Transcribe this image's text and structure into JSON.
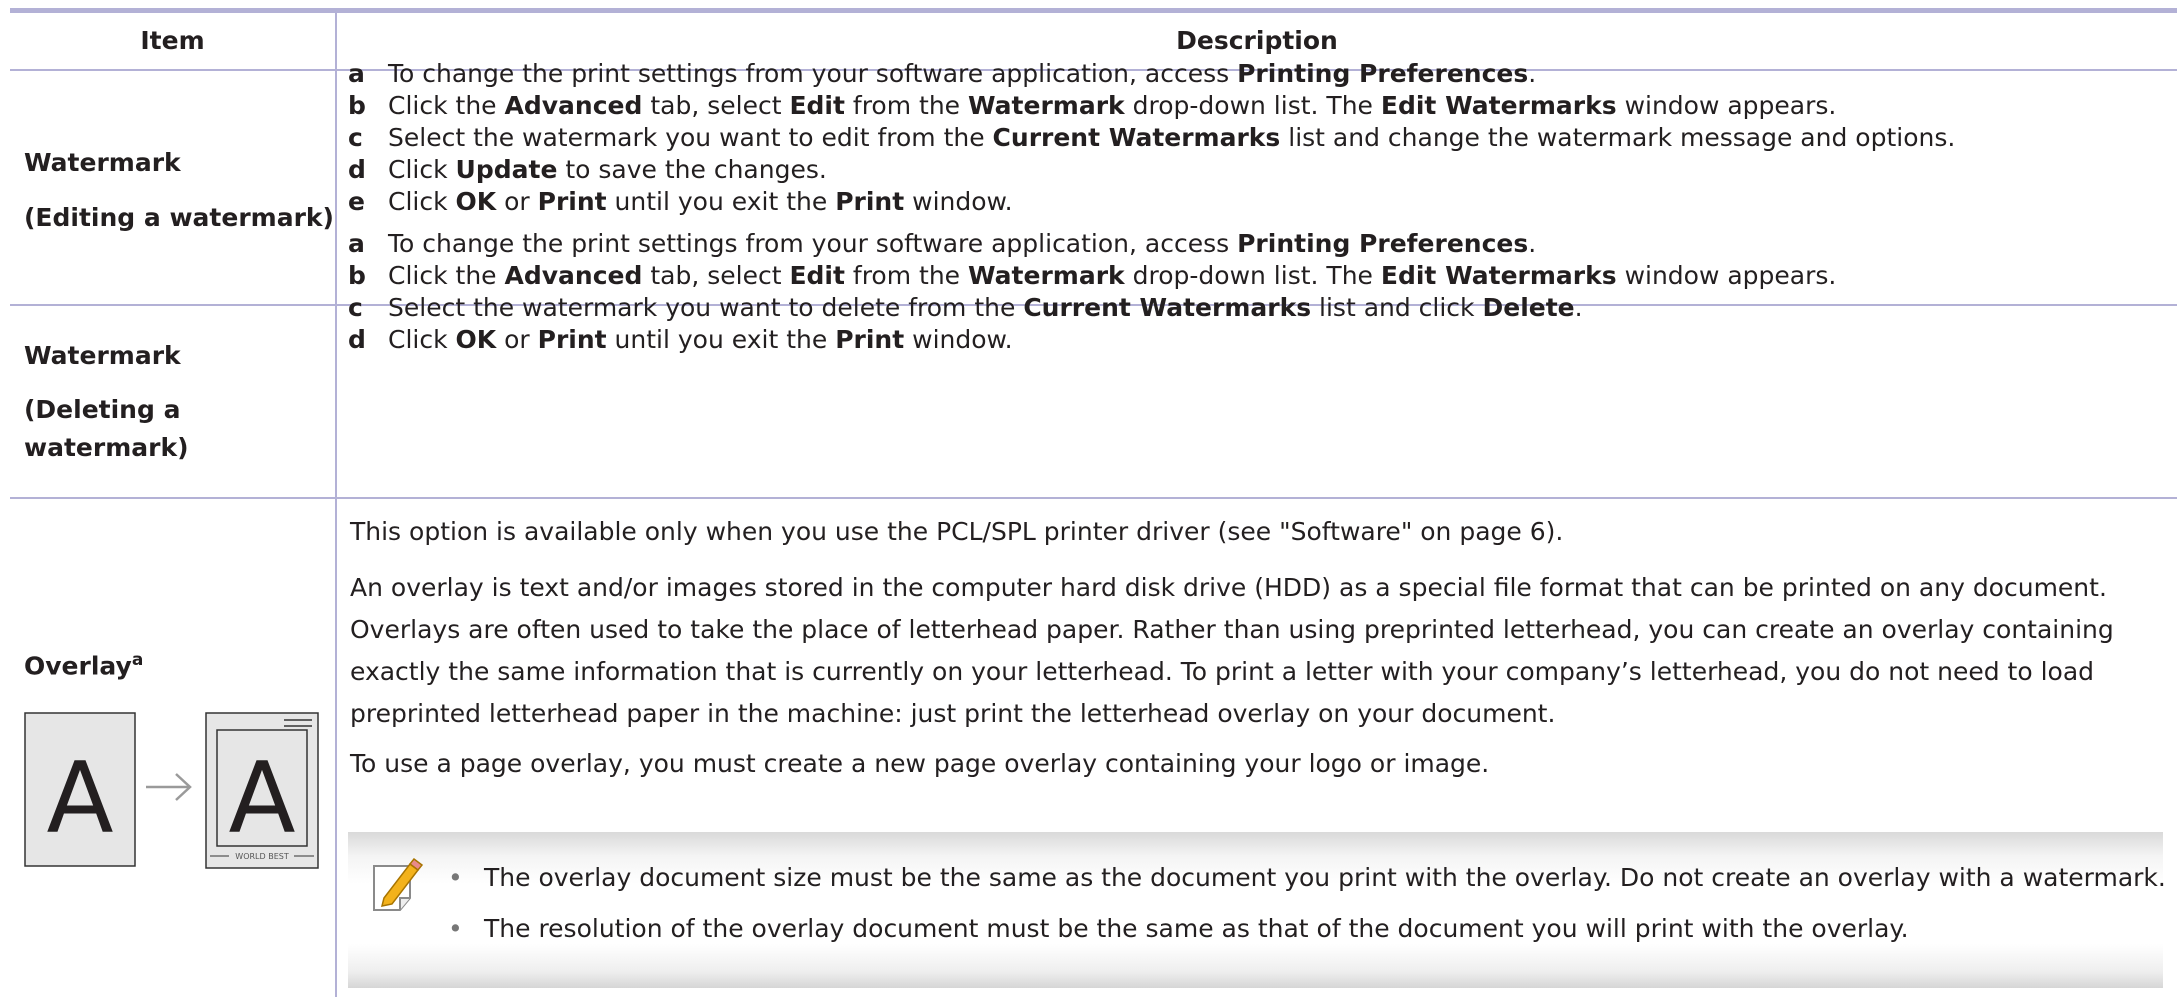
{
  "table": {
    "headers": {
      "item": "Item",
      "description": "Description"
    },
    "rows": [
      {
        "item_line1": "Watermark",
        "item_line2": "(Editing a watermark)",
        "steps": [
          {
            "letter": "a",
            "parts": [
              {
                "t": "To change the print settings from your software application, access "
              },
              {
                "t": "Printing Preferences",
                "b": true
              },
              {
                "t": "."
              }
            ]
          },
          {
            "letter": "b",
            "parts": [
              {
                "t": "Click the "
              },
              {
                "t": "Advanced",
                "b": true
              },
              {
                "t": " tab, select "
              },
              {
                "t": "Edit",
                "b": true
              },
              {
                "t": " from the "
              },
              {
                "t": "Watermark",
                "b": true
              },
              {
                "t": " drop-down list. The "
              },
              {
                "t": "Edit Watermarks",
                "b": true
              },
              {
                "t": " window appears."
              }
            ]
          },
          {
            "letter": "c",
            "parts": [
              {
                "t": "Select the watermark you want to edit from the "
              },
              {
                "t": "Current Watermarks",
                "b": true
              },
              {
                "t": " list and change the watermark message and options."
              }
            ]
          },
          {
            "letter": "d",
            "parts": [
              {
                "t": "Click "
              },
              {
                "t": "Update",
                "b": true
              },
              {
                "t": " to save the changes."
              }
            ]
          },
          {
            "letter": "e",
            "parts": [
              {
                "t": "Click "
              },
              {
                "t": "OK",
                "b": true
              },
              {
                "t": " or "
              },
              {
                "t": "Print",
                "b": true
              },
              {
                "t": " until you exit the "
              },
              {
                "t": "Print",
                "b": true
              },
              {
                "t": " window."
              }
            ]
          }
        ]
      },
      {
        "item_line1": "Watermark",
        "item_line2": "(Deleting a",
        "item_line3": "watermark)",
        "steps": [
          {
            "letter": "a",
            "parts": [
              {
                "t": "To change the print settings from your software application, access "
              },
              {
                "t": "Printing Preferences",
                "b": true
              },
              {
                "t": "."
              }
            ]
          },
          {
            "letter": "b",
            "parts": [
              {
                "t": "Click the "
              },
              {
                "t": "Advanced",
                "b": true
              },
              {
                "t": " tab, select "
              },
              {
                "t": "Edit",
                "b": true
              },
              {
                "t": " from the "
              },
              {
                "t": "Watermark",
                "b": true
              },
              {
                "t": " drop-down list. The "
              },
              {
                "t": "Edit Watermarks",
                "b": true
              },
              {
                "t": " window appears."
              }
            ]
          },
          {
            "letter": "c",
            "parts": [
              {
                "t": "Select the watermark you want to delete from the "
              },
              {
                "t": "Current Watermarks",
                "b": true
              },
              {
                "t": " list and click "
              },
              {
                "t": "Delete",
                "b": true
              },
              {
                "t": "."
              }
            ]
          },
          {
            "letter": "d",
            "parts": [
              {
                "t": "Click "
              },
              {
                "t": "OK",
                "b": true
              },
              {
                "t": " or "
              },
              {
                "t": "Print",
                "b": true
              },
              {
                "t": " until you exit the "
              },
              {
                "t": "Print",
                "b": true
              },
              {
                "t": " window."
              }
            ]
          }
        ]
      },
      {
        "item_line1": "Overlay",
        "item_sup": "a",
        "illustration": {
          "left_letter": "A",
          "right_letter": "A",
          "footer_text": "WORLD BEST"
        },
        "paragraphs": [
          "This option is available only when you use the PCL/SPL printer driver (see \"Software\" on page 6).",
          "An overlay is text and/or images stored in the computer hard disk drive (HDD) as a special file format that can be printed on any document. Overlays are often used to take the place of letterhead paper. Rather than using preprinted letterhead, you can create an overlay containing exactly the same information that is currently on your letterhead. To print a letter with your company’s letterhead, you do not need to load preprinted letterhead paper in the machine: just print the letterhead overlay on your document.",
          "To use a page overlay, you must create a new page overlay containing your logo or image."
        ],
        "note": {
          "icon": "note-pencil-icon",
          "bullet_glyph": "•",
          "bullets": [
            "The overlay document size must be the same as the document you print with the overlay. Do not create an overlay with a watermark.",
            "The resolution of the overlay document must be the same as that of the document you will print with the overlay."
          ]
        }
      }
    ]
  },
  "colors": {
    "rule": "#b3b1d6",
    "text": "#231f20",
    "note_shade": "#d9d9d9"
  }
}
